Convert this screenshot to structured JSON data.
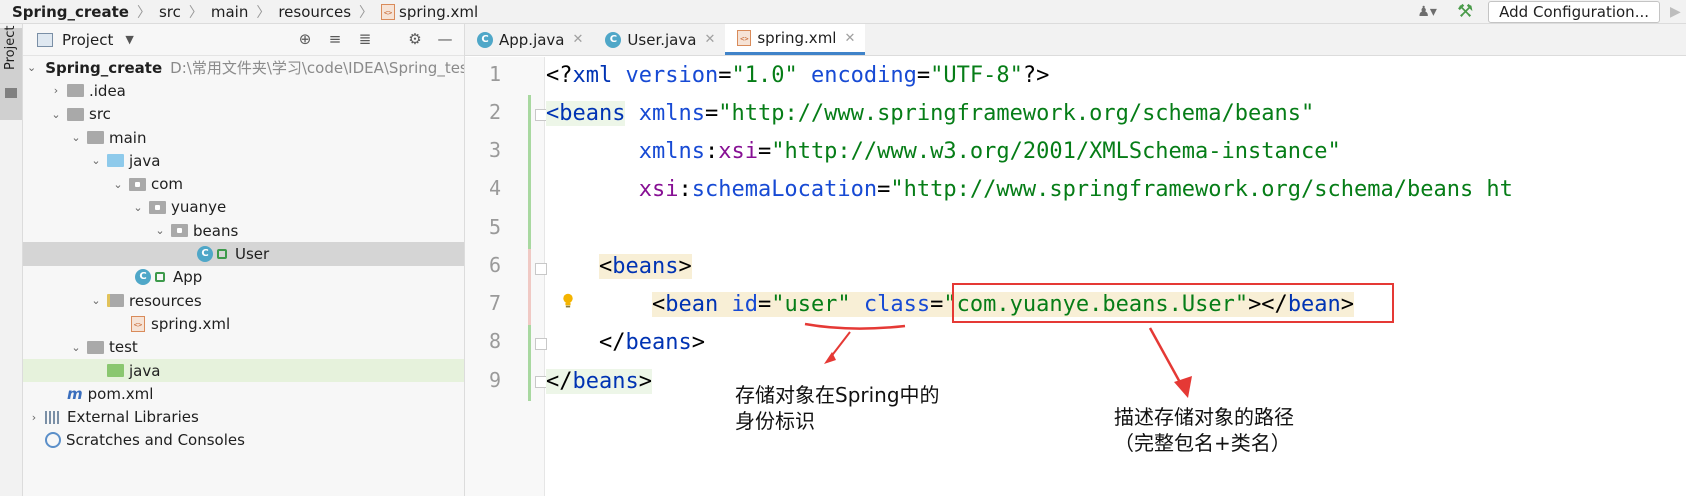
{
  "breadcrumb": {
    "items": [
      "Spring_create",
      "src",
      "main",
      "resources",
      "spring.xml"
    ]
  },
  "toolbar": {
    "add_configuration": "Add Configuration..."
  },
  "toolstrip": {
    "project_tab": "Project"
  },
  "project_panel": {
    "title": "Project",
    "tree": [
      {
        "label": "Spring_create",
        "path": "D:\\常用文件夹\\学习\\code\\IDEA\\Spring_test\\S"
      },
      {
        "label": ".idea"
      },
      {
        "label": "src"
      },
      {
        "label": "main"
      },
      {
        "label": "java"
      },
      {
        "label": "com"
      },
      {
        "label": "yuanye"
      },
      {
        "label": "beans"
      },
      {
        "label": "User"
      },
      {
        "label": "App"
      },
      {
        "label": "resources"
      },
      {
        "label": "spring.xml"
      },
      {
        "label": "test"
      },
      {
        "label": "java"
      },
      {
        "label": "pom.xml"
      },
      {
        "label": "External Libraries"
      },
      {
        "label": "Scratches and Consoles"
      }
    ]
  },
  "editor": {
    "tabs": [
      "App.java",
      "User.java",
      "spring.xml"
    ],
    "active_tab": "spring.xml",
    "line_numbers": [
      "1",
      "2",
      "3",
      "4",
      "5",
      "6",
      "7",
      "8",
      "9"
    ],
    "lines": {
      "l1": {
        "open": "<?",
        "tag": "xml",
        "a1": " version",
        "eq1": "=",
        "v1": "\"1.0\"",
        "a2": " encoding",
        "eq2": "=",
        "v2": "\"UTF-8\"",
        "close": "?>"
      },
      "l2": {
        "open": "<",
        "tag": "beans",
        "a1": " xmlns",
        "eq1": "=",
        "v1": "\"http://www.springframework.org/schema/beans\""
      },
      "l3": {
        "indent": "       ",
        "a1": "xmlns",
        "colon": ":",
        "ns": "xsi",
        "eq1": "=",
        "v1": "\"http://www.w3.org/2001/XMLSchema-instance\""
      },
      "l4": {
        "indent": "       ",
        "a1": "xsi",
        "colon": ":",
        "ns": "schemaLocation",
        "eq1": "=",
        "v1": "\"http://www.springframework.org/schema/beans ht"
      },
      "l6": {
        "indent": "    ",
        "open": "<",
        "tag": "beans",
        "close": ">"
      },
      "l7": {
        "indent": "        ",
        "open": "<",
        "tag": "bean",
        "a1": " id",
        "eq1": "=",
        "v1": "\"user\"",
        "a2": " class",
        "eq2": "=",
        "v2": "\"com.yuanye.beans.User\"",
        "close": "></",
        "tag2": "bean",
        "close2": ">"
      },
      "l8": {
        "indent": "    ",
        "open": "</",
        "tag": "beans",
        "close": ">"
      },
      "l9": {
        "open": "</",
        "tag": "beans",
        "close": ">"
      }
    }
  },
  "annotations": {
    "id_note_line1": "存储对象在Spring中的",
    "id_note_line2": "身份标识",
    "class_note_line1": "描述存储对象的路径",
    "class_note_line2": "（完整包名+类名）"
  },
  "colors": {
    "tag": "#0033b3",
    "attr": "#174ad4",
    "namespace": "#871094",
    "value": "#067d17",
    "annotation_red": "#e53935"
  }
}
